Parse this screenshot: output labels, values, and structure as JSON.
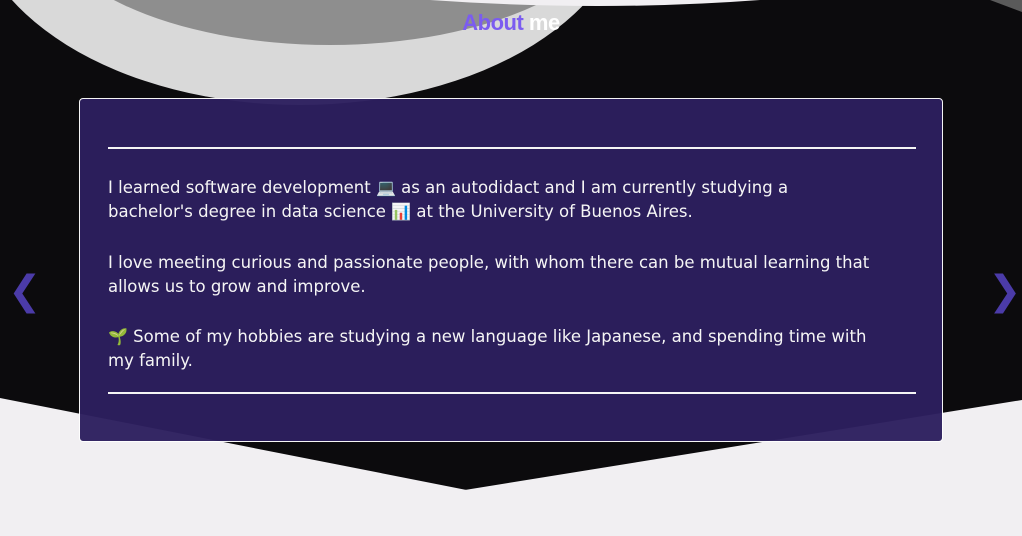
{
  "section": {
    "title_accent": "About",
    "title_rest": " me"
  },
  "carousel": {
    "prev_symbol": "❮",
    "next_symbol": "❯"
  },
  "about": {
    "paragraphs": [
      {
        "before": "I learned software development ",
        "emoji": "💻",
        "after": " as an autodidact and I am currently studying a bachelor's degree in data science ",
        "emoji2": "📊",
        "after2": " at the University of Buenos Aires."
      },
      {
        "text": "I love meeting curious and passionate people, with whom there can be mutual learning that allows us to grow and improve."
      },
      {
        "emoji": "🌱",
        "text": " Some of my hobbies are studying a new language like Japanese, and spending time with my family."
      }
    ]
  },
  "colors": {
    "background": "#0c0b0d",
    "accent": "#7b5cf0",
    "card": "#2d1f5f",
    "arrow": "#4b3ba8",
    "light_shape": "#f1eff2",
    "gray_shape": "#8e8e8e"
  }
}
